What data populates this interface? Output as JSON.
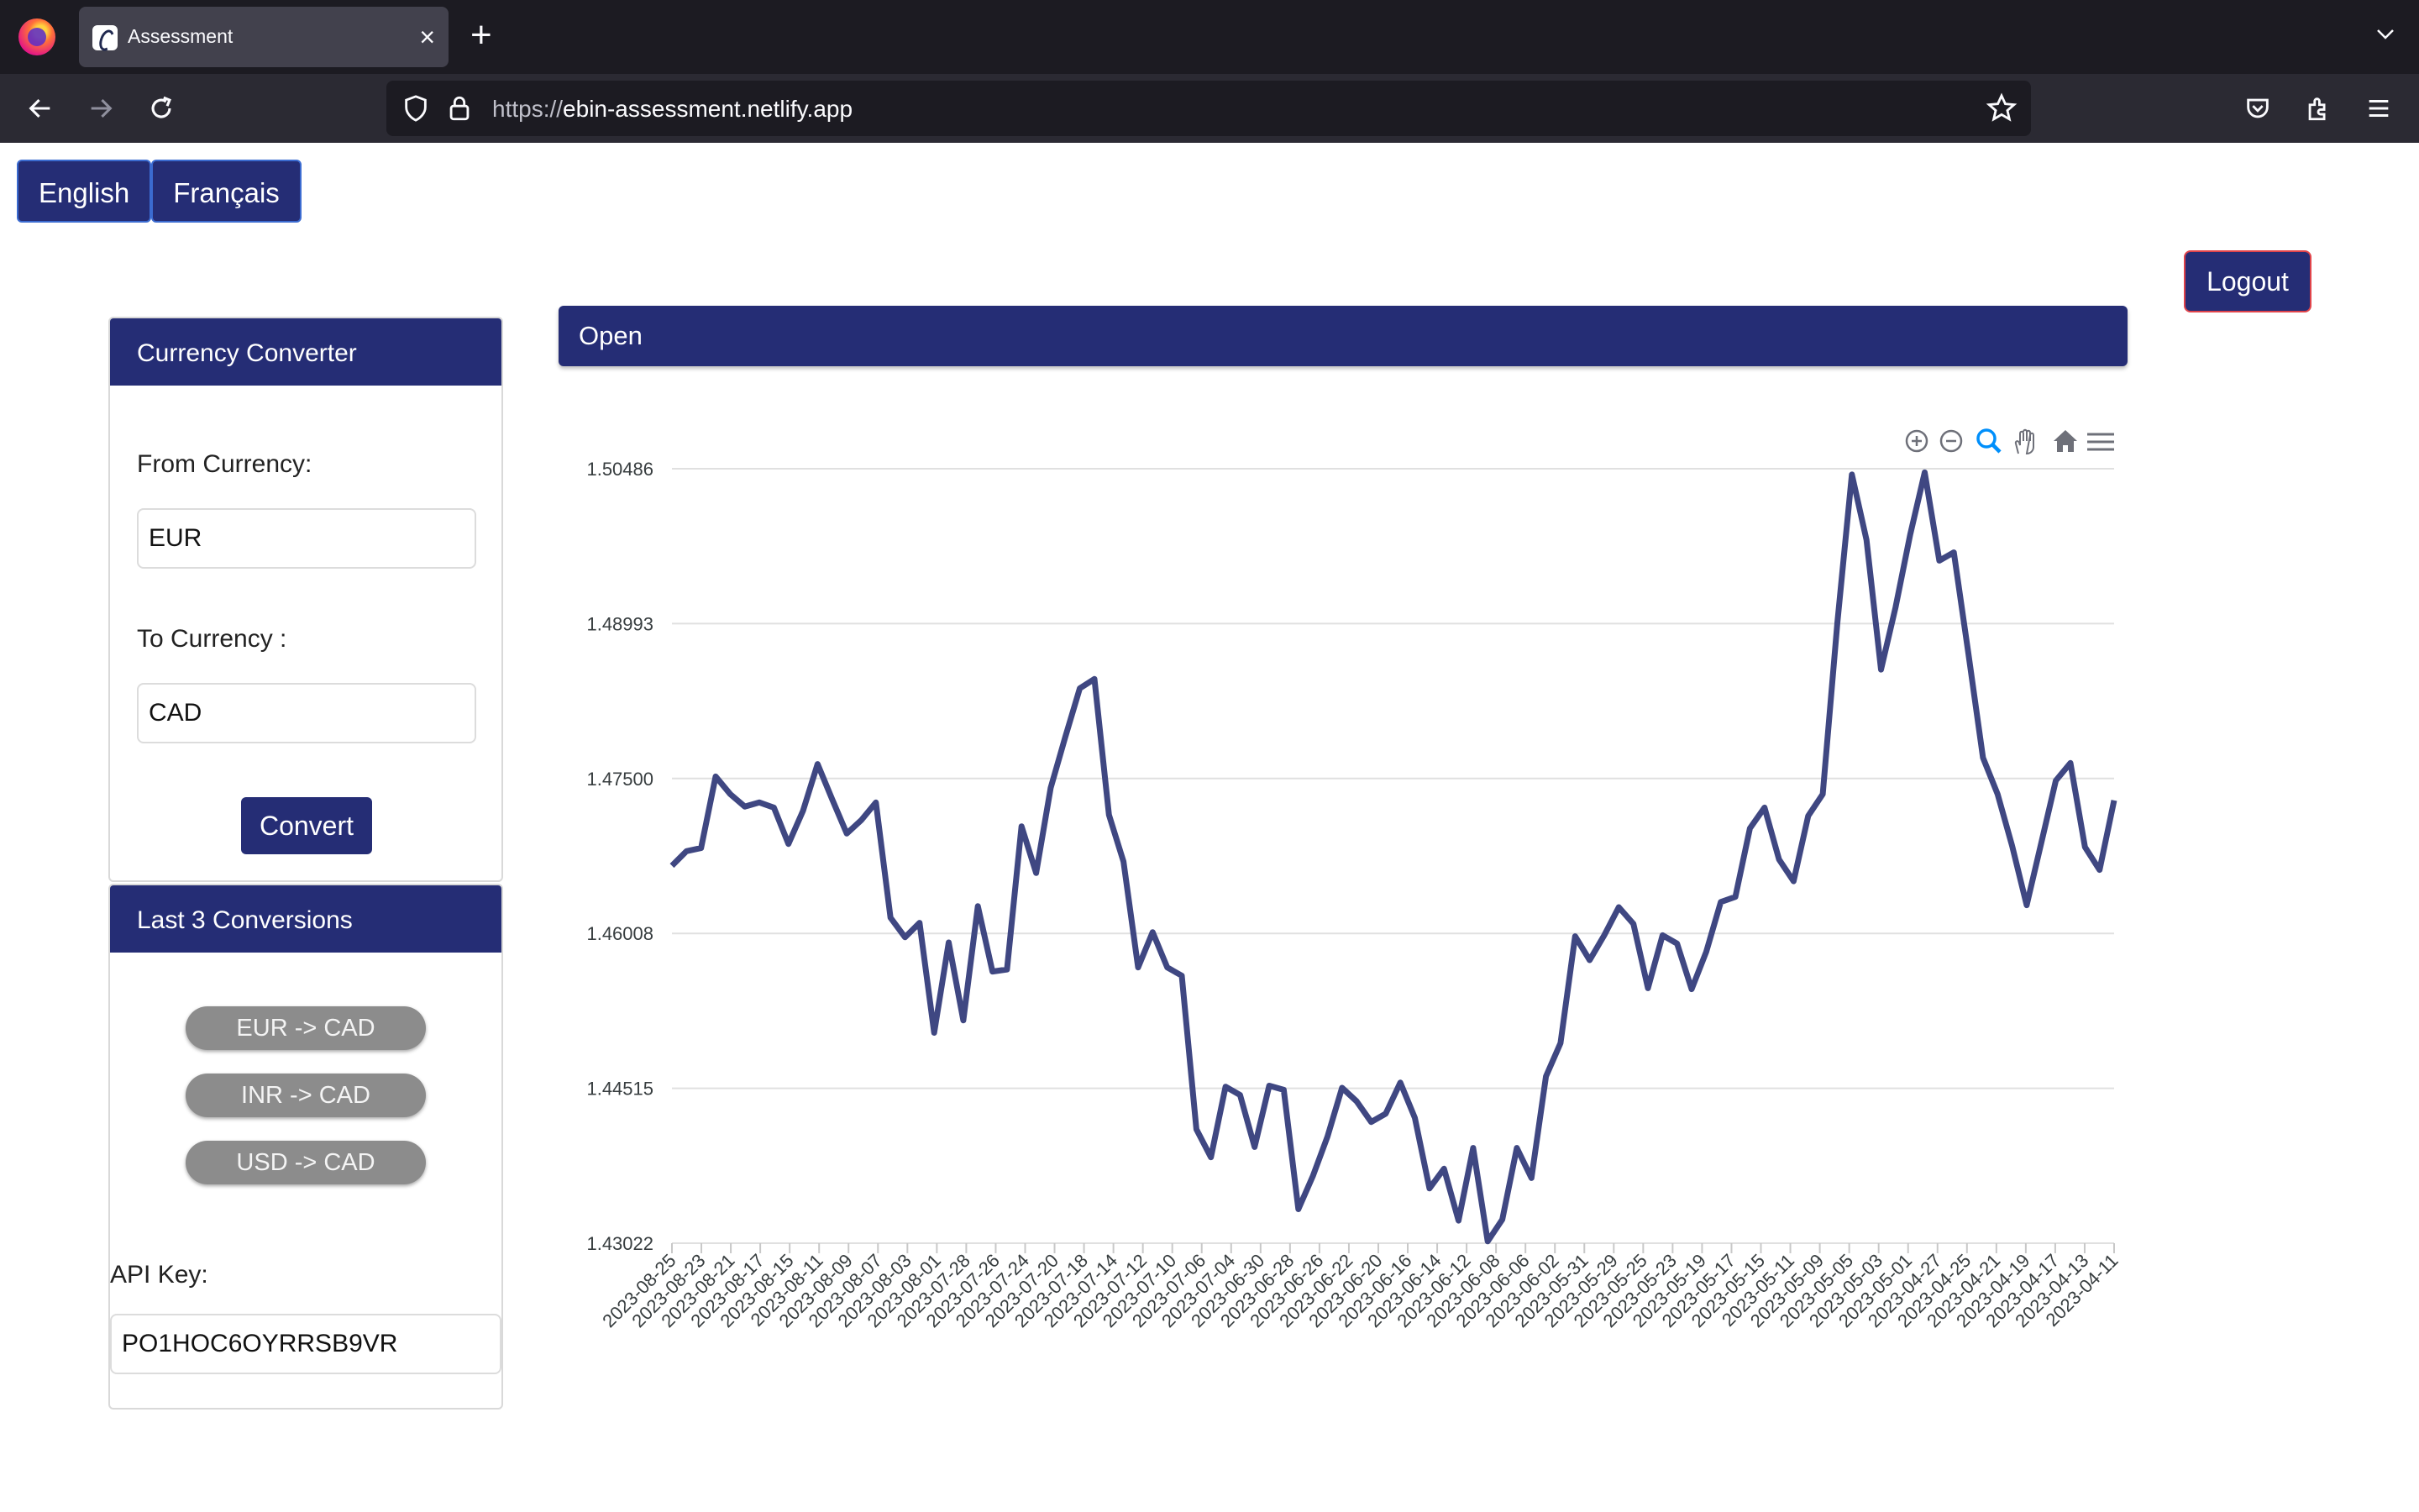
{
  "browser": {
    "tab_title": "Assessment",
    "tab_close": "×",
    "new_tab": "+",
    "url_scheme": "https://",
    "url_host": "ebin-assessment.netlify.app"
  },
  "languages": [
    "English",
    "Français"
  ],
  "logout_label": "Logout",
  "converter": {
    "title": "Currency Converter",
    "from_label": "From Currency:",
    "from_value": "EUR",
    "to_label": "To Currency :",
    "to_value": "CAD",
    "convert_label": "Convert"
  },
  "history": {
    "title": "Last 3 Conversions",
    "items": [
      "EUR -> CAD",
      "INR -> CAD",
      "USD -> CAD"
    ],
    "api_label": "API Key:",
    "api_value": "PO1HOC6OYRRSB9VR"
  },
  "chart_panel": {
    "title": "Open"
  },
  "chart_data": {
    "type": "line",
    "title": "",
    "xlabel": "",
    "ylabel": "",
    "series": [
      {
        "name": "Open",
        "color": "#3f4782"
      }
    ],
    "yticks": [
      "1.50486",
      "1.48993",
      "1.47500",
      "1.46008",
      "1.44515",
      "1.43022"
    ],
    "ylim": [
      1.43022,
      1.50486
    ],
    "xtick_labels": [
      "2023-08-25",
      "2023-08-23",
      "2023-08-21",
      "2023-08-17",
      "2023-08-15",
      "2023-08-11",
      "2023-08-09",
      "2023-08-07",
      "2023-08-03",
      "2023-08-01",
      "2023-07-28",
      "2023-07-26",
      "2023-07-24",
      "2023-07-20",
      "2023-07-18",
      "2023-07-14",
      "2023-07-12",
      "2023-07-10",
      "2023-07-06",
      "2023-07-04",
      "2023-06-30",
      "2023-06-28",
      "2023-06-26",
      "2023-06-22",
      "2023-06-20",
      "2023-06-16",
      "2023-06-14",
      "2023-06-12",
      "2023-06-08",
      "2023-06-06",
      "2023-06-02",
      "2023-05-31",
      "2023-05-29",
      "2023-05-25",
      "2023-05-23",
      "2023-05-19",
      "2023-05-17",
      "2023-05-15",
      "2023-05-11",
      "2023-05-09",
      "2023-05-05",
      "2023-05-03",
      "2023-05-01",
      "2023-04-27",
      "2023-04-25",
      "2023-04-21",
      "2023-04-19",
      "2023-04-17",
      "2023-04-13",
      "2023-04-11"
    ],
    "values": [
      1.4666,
      1.468,
      1.4683,
      1.4752,
      1.4735,
      1.4723,
      1.4727,
      1.4722,
      1.4687,
      1.4719,
      1.4764,
      1.473,
      1.4697,
      1.471,
      1.4727,
      1.4616,
      1.4597,
      1.4611,
      1.4505,
      1.4592,
      1.4517,
      1.4627,
      1.4564,
      1.4566,
      1.4704,
      1.4659,
      1.4741,
      1.479,
      1.4837,
      1.4846,
      1.4715,
      1.467,
      1.4568,
      1.4602,
      1.4568,
      1.456,
      1.4412,
      1.4385,
      1.4453,
      1.4445,
      1.4395,
      1.4454,
      1.445,
      1.4335,
      1.4367,
      1.4405,
      1.4452,
      1.4439,
      1.4419,
      1.4427,
      1.4457,
      1.4423,
      1.4355,
      1.4374,
      1.4324,
      1.4394,
      1.4304,
      1.4325,
      1.4394,
      1.4365,
      1.4463,
      1.4495,
      1.4598,
      1.4575,
      1.4599,
      1.4626,
      1.461,
      1.4548,
      1.4599,
      1.4591,
      1.4547,
      1.4583,
      1.4631,
      1.4636,
      1.4702,
      1.4722,
      1.4672,
      1.4651,
      1.4714,
      1.4735,
      1.49,
      1.5043,
      1.498,
      1.4855,
      1.4915,
      1.4985,
      1.5045,
      1.496,
      1.4968,
      1.487,
      1.477,
      1.4735,
      1.4685,
      1.4628,
      1.4688,
      1.4748,
      1.4765,
      1.4684,
      1.4662,
      1.4729
    ]
  }
}
